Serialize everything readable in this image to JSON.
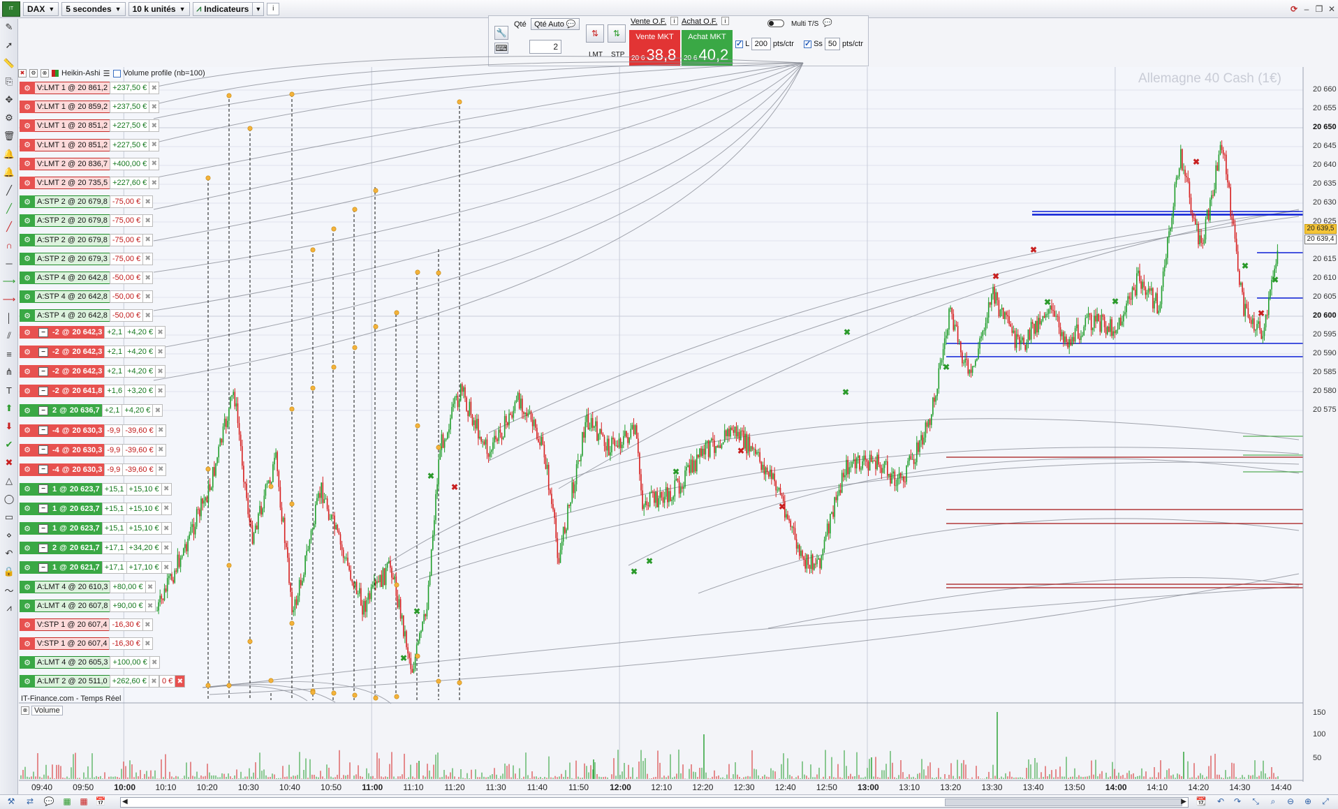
{
  "toolbar": {
    "logo_text": "IT",
    "symbol": "DAX",
    "interval": "5 secondes",
    "volume_unit": "10 k unités",
    "indicators_label": "Indicateurs",
    "info_icon": "info-icon"
  },
  "order_panel": {
    "qty_label": "Qté",
    "qty_auto_label": "Qté Auto",
    "qty_value": "2",
    "sell_of_label": "Vente O.F.",
    "buy_of_label": "Achat O.F.",
    "lmt_label": "LMT",
    "stp_label": "STP",
    "sell_mkt_label": "Vente MKT",
    "buy_mkt_label": "Achat MKT",
    "sell_price_prefix": "20 6",
    "sell_price_main": "38,8",
    "buy_price_prefix": "20 6",
    "buy_price_main": "40,2",
    "multi_ts_label": "Multi T/S",
    "l_label": "L",
    "l_value": "200",
    "ss_label": "Ss",
    "ss_value": "50",
    "pts_ctr_label": "pts/ctr",
    "sell_color": "#e23434",
    "buy_color": "#3aa845"
  },
  "chart_header": {
    "candle_type": "Heikin-Ashi",
    "volume_profile": "Volume profile (nb=100)"
  },
  "chart": {
    "watermark": "Allemagne 40 Cash (1€)",
    "source_label": "IT-Finance.com - Temps Réel",
    "volume_panel_label": "Volume",
    "last_price": "20 639,5",
    "current_price": "20 639,4"
  },
  "orders": [
    {
      "label": "V:LMT  1  @  20 861,2",
      "pnl": "+237,50 €",
      "color": "red"
    },
    {
      "label": "V:LMT  1  @  20 859,2",
      "pnl": "+237,50 €",
      "color": "red"
    },
    {
      "label": "V:LMT  1  @  20 851,2",
      "pnl": "+227,50 €",
      "color": "red"
    },
    {
      "label": "V:LMT  1  @  20 851,2",
      "pnl": "+227,50 €",
      "color": "red"
    },
    {
      "label": "V:LMT  2  @  20 836,7",
      "pnl": "+400,00 €",
      "color": "red"
    },
    {
      "label": "V:LMT  2  @  20 735,5",
      "pnl": "+227,60 €",
      "color": "red"
    },
    {
      "label": "A:STP  2  @  20 679,8",
      "pnl": "-75,00 €",
      "color": "green"
    },
    {
      "label": "A:STP  2  @  20 679,8",
      "pnl": "-75,00 €",
      "color": "green"
    },
    {
      "label": "A:STP  2  @  20 679,8",
      "pnl": "-75,00 €",
      "color": "green"
    },
    {
      "label": "A:STP  2  @  20 679,3",
      "pnl": "-75,00 €",
      "color": "green"
    },
    {
      "label": "A:STP  4  @  20 642,8",
      "pnl": "-50,00 €",
      "color": "green"
    },
    {
      "label": "A:STP  4  @  20 642,8",
      "pnl": "-50,00 €",
      "color": "green"
    },
    {
      "label": "A:STP  4  @  20 642,8",
      "pnl": "-50,00 €",
      "color": "green"
    }
  ],
  "positions": [
    {
      "qty": "-2",
      "price": "20 642,3",
      "pts": "+2,1",
      "pnl": "+4,20 €",
      "color": "red"
    },
    {
      "qty": "-2",
      "price": "20 642,3",
      "pts": "+2,1",
      "pnl": "+4,20 €",
      "color": "red"
    },
    {
      "qty": "-2",
      "price": "20 642,3",
      "pts": "+2,1",
      "pnl": "+4,20 €",
      "color": "red"
    },
    {
      "qty": "-2",
      "price": "20 641,8",
      "pts": "+1,6",
      "pnl": "+3,20 €",
      "color": "red"
    },
    {
      "qty": "2",
      "price": "20 636,7",
      "pts": "+2,1",
      "pnl": "+4,20 €",
      "color": "green"
    },
    {
      "qty": "-4",
      "price": "20 630,3",
      "pts": "-9,9",
      "pnl": "-39,60 €",
      "color": "red"
    },
    {
      "qty": "-4",
      "price": "20 630,3",
      "pts": "-9,9",
      "pnl": "-39,60 €",
      "color": "red"
    },
    {
      "qty": "-4",
      "price": "20 630,3",
      "pts": "-9,9",
      "pnl": "-39,60 €",
      "color": "red"
    },
    {
      "qty": "1",
      "price": "20 623,7",
      "pts": "+15,1",
      "pnl": "+15,10 €",
      "color": "green"
    },
    {
      "qty": "1",
      "price": "20 623,7",
      "pts": "+15,1",
      "pnl": "+15,10 €",
      "color": "green"
    },
    {
      "qty": "1",
      "price": "20 623,7",
      "pts": "+15,1",
      "pnl": "+15,10 €",
      "color": "green"
    },
    {
      "qty": "2",
      "price": "20 621,7",
      "pts": "+17,1",
      "pnl": "+34,20 €",
      "color": "green"
    },
    {
      "qty": "1",
      "price": "20 621,7",
      "pts": "+17,1",
      "pnl": "+17,10 €",
      "color": "green"
    }
  ],
  "lower_orders": [
    {
      "label": "A:LMT  4  @  20 610,3",
      "pnl": "+80,00 €",
      "color": "green"
    },
    {
      "label": "A:LMT  4  @  20 607,8",
      "pnl": "+90,00 €",
      "color": "green"
    },
    {
      "label": "V:STP  1  @  20 607,4",
      "pnl": "-16,30 €",
      "color": "red"
    },
    {
      "label": "V:STP  1  @  20 607,4",
      "pnl": "-16,30 €",
      "color": "red"
    },
    {
      "label": "A:LMT  4  @  20 605,3",
      "pnl": "+100,00 €",
      "color": "green"
    },
    {
      "label": "A:LMT  2  @  20 511,0",
      "pnl": "+262,60 €",
      "color": "green"
    }
  ],
  "extra_tag": "0 €",
  "price_axis": [
    {
      "label": "20 660",
      "bold": false
    },
    {
      "label": "20 655",
      "bold": false
    },
    {
      "label": "20 650",
      "bold": true
    },
    {
      "label": "20 645",
      "bold": false
    },
    {
      "label": "20 640",
      "bold": false
    },
    {
      "label": "20 635",
      "bold": false
    },
    {
      "label": "20 630",
      "bold": false
    },
    {
      "label": "20 625",
      "bold": false
    },
    {
      "label": "20 620",
      "bold": false
    },
    {
      "label": "20 615",
      "bold": false
    },
    {
      "label": "20 610",
      "bold": false
    },
    {
      "label": "20 605",
      "bold": false
    },
    {
      "label": "20 600",
      "bold": true
    },
    {
      "label": "20 595",
      "bold": false
    },
    {
      "label": "20 590",
      "bold": false
    },
    {
      "label": "20 585",
      "bold": false
    },
    {
      "label": "20 580",
      "bold": false
    },
    {
      "label": "20 575",
      "bold": false
    }
  ],
  "volume_axis": [
    "150",
    "100",
    "50"
  ],
  "time_axis": [
    {
      "label": "09:40",
      "bold": false
    },
    {
      "label": "09:50",
      "bold": false
    },
    {
      "label": "10:00",
      "bold": true
    },
    {
      "label": "10:10",
      "bold": false
    },
    {
      "label": "10:20",
      "bold": false
    },
    {
      "label": "10:30",
      "bold": false
    },
    {
      "label": "10:40",
      "bold": false
    },
    {
      "label": "10:50",
      "bold": false
    },
    {
      "label": "11:00",
      "bold": true
    },
    {
      "label": "11:10",
      "bold": false
    },
    {
      "label": "11:20",
      "bold": false
    },
    {
      "label": "11:30",
      "bold": false
    },
    {
      "label": "11:40",
      "bold": false
    },
    {
      "label": "11:50",
      "bold": false
    },
    {
      "label": "12:00",
      "bold": true
    },
    {
      "label": "12:10",
      "bold": false
    },
    {
      "label": "12:20",
      "bold": false
    },
    {
      "label": "12:30",
      "bold": false
    },
    {
      "label": "12:40",
      "bold": false
    },
    {
      "label": "12:50",
      "bold": false
    },
    {
      "label": "13:00",
      "bold": true
    },
    {
      "label": "13:10",
      "bold": false
    },
    {
      "label": "13:20",
      "bold": false
    },
    {
      "label": "13:30",
      "bold": false
    },
    {
      "label": "13:40",
      "bold": false
    },
    {
      "label": "13:50",
      "bold": false
    },
    {
      "label": "14:00",
      "bold": true
    },
    {
      "label": "14:10",
      "bold": false
    },
    {
      "label": "14:20",
      "bold": false
    },
    {
      "label": "14:30",
      "bold": false
    },
    {
      "label": "14:40",
      "bold": false
    }
  ],
  "colors": {
    "up_candle": "#1f9d2a",
    "down_candle": "#d61f1f",
    "horizontal_blue": "#0b1fd6",
    "horizontal_red": "#a51414",
    "marker_orange": "#f3b23b"
  }
}
